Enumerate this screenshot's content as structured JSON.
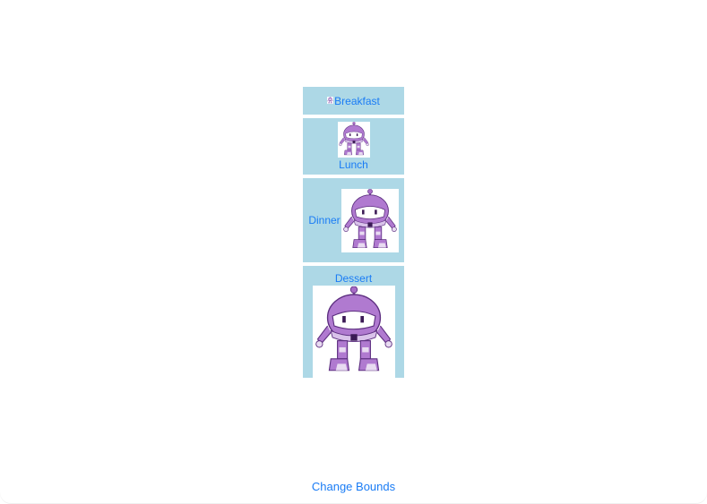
{
  "menu": {
    "items": [
      {
        "label": "Breakfast",
        "icon": "robot-icon"
      },
      {
        "label": "Lunch",
        "icon": "robot-icon"
      },
      {
        "label": "Dinner",
        "icon": "robot-icon"
      },
      {
        "label": "Dessert",
        "icon": "robot-icon"
      }
    ]
  },
  "footer": {
    "change_bounds_label": "Change Bounds"
  },
  "colors": {
    "button_background": "#add8e6",
    "link_text": "#1a7cf5",
    "robot_primary": "#a86cc7",
    "robot_shade": "#7e4aa3"
  }
}
